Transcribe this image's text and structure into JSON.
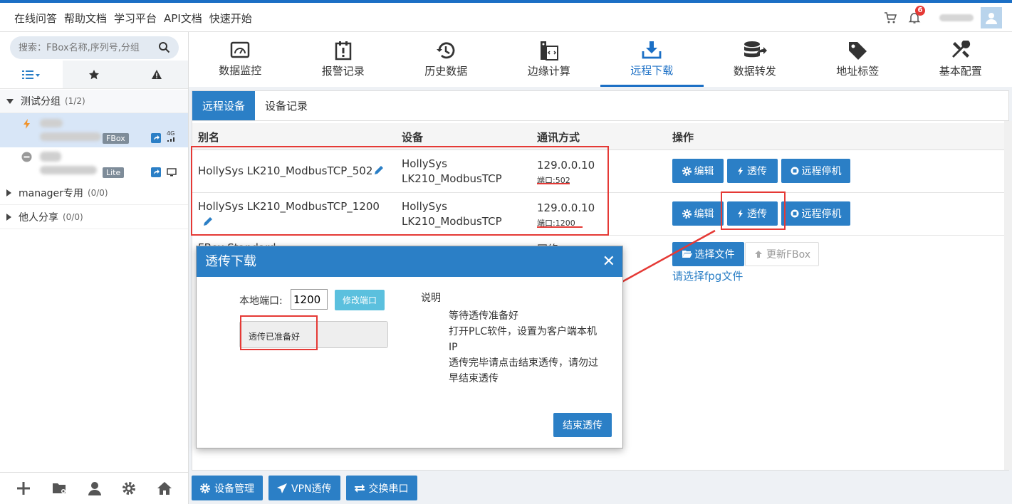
{
  "topnav": [
    "在线问答",
    "帮助文档",
    "学习平台",
    "API文档",
    "快速开始"
  ],
  "notifications": {
    "count": "6"
  },
  "colors": {
    "primary": "#2b7fc6",
    "accent_bar": "#1b6fc5",
    "annotation": "#e53935",
    "info": "#5bc0de"
  },
  "sidebar": {
    "search_placeholder": "搜索：FBox名称,序列号,分组",
    "groups": [
      {
        "name": "测试分组",
        "count": "(1/2)"
      },
      {
        "name": "manager专用",
        "count": "(0/0)"
      },
      {
        "name": "他人分享",
        "count": "(0/0)"
      }
    ],
    "devices": [
      {
        "badge": "FBox",
        "signal": "4G"
      },
      {
        "badge": "Lite"
      }
    ]
  },
  "nav_items": [
    {
      "label": "数据监控",
      "icon": "monitor-icon"
    },
    {
      "label": "报警记录",
      "icon": "alarm-icon"
    },
    {
      "label": "历史数据",
      "icon": "history-icon"
    },
    {
      "label": "边缘计算",
      "icon": "edge-compute-icon"
    },
    {
      "label": "远程下载",
      "icon": "download-icon"
    },
    {
      "label": "数据转发",
      "icon": "database-forward-icon"
    },
    {
      "label": "地址标签",
      "icon": "tag-icon"
    },
    {
      "label": "基本配置",
      "icon": "tools-icon"
    }
  ],
  "subtabs": [
    "远程设备",
    "设备记录"
  ],
  "table": {
    "headers": [
      "别名",
      "设备",
      "通讯方式",
      "操作"
    ],
    "rows": [
      {
        "alias": "HollySys LK210_ModbusTCP_502",
        "device_l1": "HollySys",
        "device_l2": "LK210_ModbusTCP",
        "ip": "129.0.0.10",
        "port": "端口:502"
      },
      {
        "alias": "HollySys LK210_ModbusTCP_1200",
        "device_l1": "HollySys",
        "device_l2": "LK210_ModbusTCP",
        "ip": "129.0.0.10",
        "port": "端口:1200"
      }
    ],
    "row3_alias": "FBox Standard",
    "row3_comm": "网络",
    "actions": {
      "edit": "编辑",
      "passthrough": "透传",
      "remote_stop": "远程停机"
    },
    "select_file": "选择文件",
    "update_fbox": "更新FBox",
    "choose_hint": "请选择fpg文件"
  },
  "bottom_buttons": [
    "设备管理",
    "VPN透传",
    "交换串口"
  ],
  "modal": {
    "title": "透传下载",
    "port_label": "本地端口:",
    "port_value": "1200",
    "modify_button": "修改端口",
    "status": "透传已准备好",
    "desc_title": "说明",
    "desc_items": [
      "等待透传准备好",
      "打开PLC软件，设置为客户端本机IP",
      "透传完毕请点击结束透传，请勿过早结束透传"
    ],
    "end_button": "结束透传"
  }
}
